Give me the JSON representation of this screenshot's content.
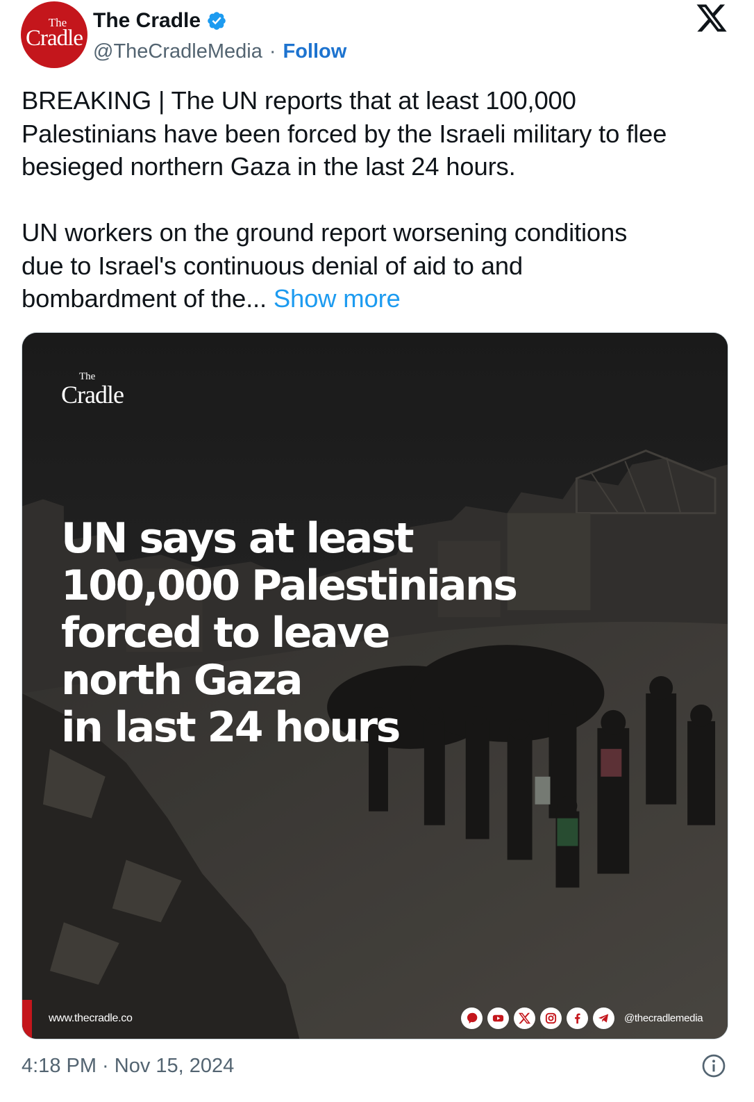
{
  "author": {
    "avatar_line1": "The",
    "avatar_line2": "Cradle",
    "display_name": "The Cradle",
    "verified": true,
    "handle": "@TheCradleMedia",
    "separator": "·",
    "follow_label": "Follow"
  },
  "platform_logo": "x-logo-icon",
  "tweet": {
    "paragraph1": "BREAKING | The UN reports that at least 100,000\nPalestinians have been forced by the Israeli military to flee\nbesieged northern Gaza in the last 24 hours.",
    "paragraph2": "UN workers on the ground report worsening conditions\ndue to Israel's continuous denial of aid to and\nbombardment of the... ",
    "show_more_label": "Show more"
  },
  "media": {
    "logo_line1": "The",
    "logo_line2": "Cradle",
    "headline": [
      "UN says at least",
      "100,000 Palestinians",
      "forced to leave",
      "north Gaza",
      "in last 24 hours"
    ],
    "website": "www.thecradle.co",
    "social_icons": [
      "podcast-icon",
      "youtube-icon",
      "x-icon",
      "instagram-icon",
      "facebook-icon",
      "telegram-icon"
    ],
    "social_handle": "@thecradlemedia"
  },
  "timestamp": "4:18 PM · Nov 15, 2024",
  "colors": {
    "follow": "#1d73cf",
    "show_more": "#1d9bf0",
    "brand_red": "#c4161c",
    "verified_blue": "#1d9bf0",
    "secondary_text": "#536471"
  }
}
